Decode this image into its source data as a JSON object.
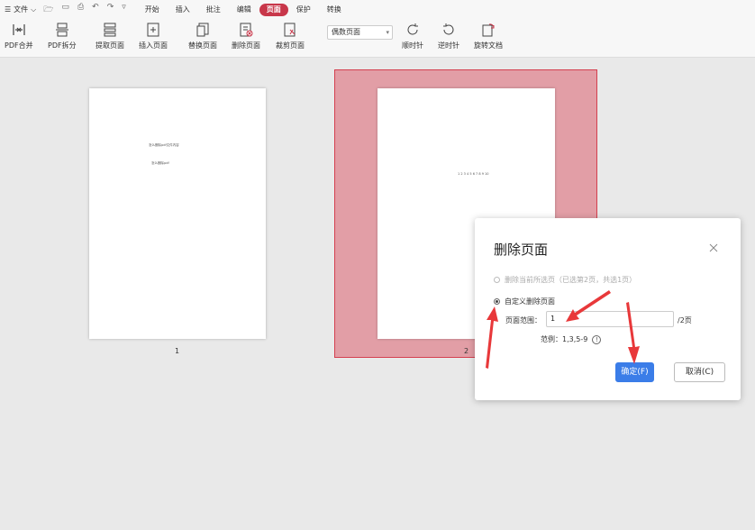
{
  "menubar": {
    "file_label": "文件",
    "tabs": [
      "开始",
      "插入",
      "批注",
      "编辑",
      "页面",
      "保护",
      "转换"
    ],
    "active_tab": "页面"
  },
  "toolbar": {
    "tools": [
      {
        "label": "PDF合并",
        "icon": "merge-icon"
      },
      {
        "label": "PDF拆分",
        "icon": "split-icon"
      },
      {
        "label": "提取页面",
        "icon": "extract-icon"
      },
      {
        "label": "插入页面",
        "icon": "insert-page-icon"
      },
      {
        "label": "替换页面",
        "icon": "replace-page-icon"
      },
      {
        "label": "删除页面",
        "icon": "delete-page-icon"
      },
      {
        "label": "裁剪页面",
        "icon": "crop-page-icon"
      },
      {
        "label": "顺时针",
        "icon": "rotate-cw-icon"
      },
      {
        "label": "逆时针",
        "icon": "rotate-ccw-icon"
      },
      {
        "label": "旋转文档",
        "icon": "rotate-doc-icon"
      }
    ],
    "page_select": "偶数页面"
  },
  "pages": {
    "page1_line1": "怎么删除pdf文件内容",
    "page1_line2": "怎么删除pdf",
    "page1_number": "1",
    "page2_line1": "1 2 3 4 5 6 7 8 9 10",
    "page2_number": "2"
  },
  "dialog": {
    "title": "删除页面",
    "option_current": "删除当前所选页（已选第2页，共选1页）",
    "option_custom": "自定义删除页面",
    "range_label": "页面范围：",
    "range_value": "1",
    "range_suffix": "/2页",
    "example": "范例：1,3,5-9",
    "ok_label": "确定(F)",
    "cancel_label": "取消(C)"
  },
  "colors": {
    "active_tab": "#c8374a",
    "selection": "#e29ea6",
    "primary_button": "#3b7de8",
    "arrow": "#e8383a"
  }
}
